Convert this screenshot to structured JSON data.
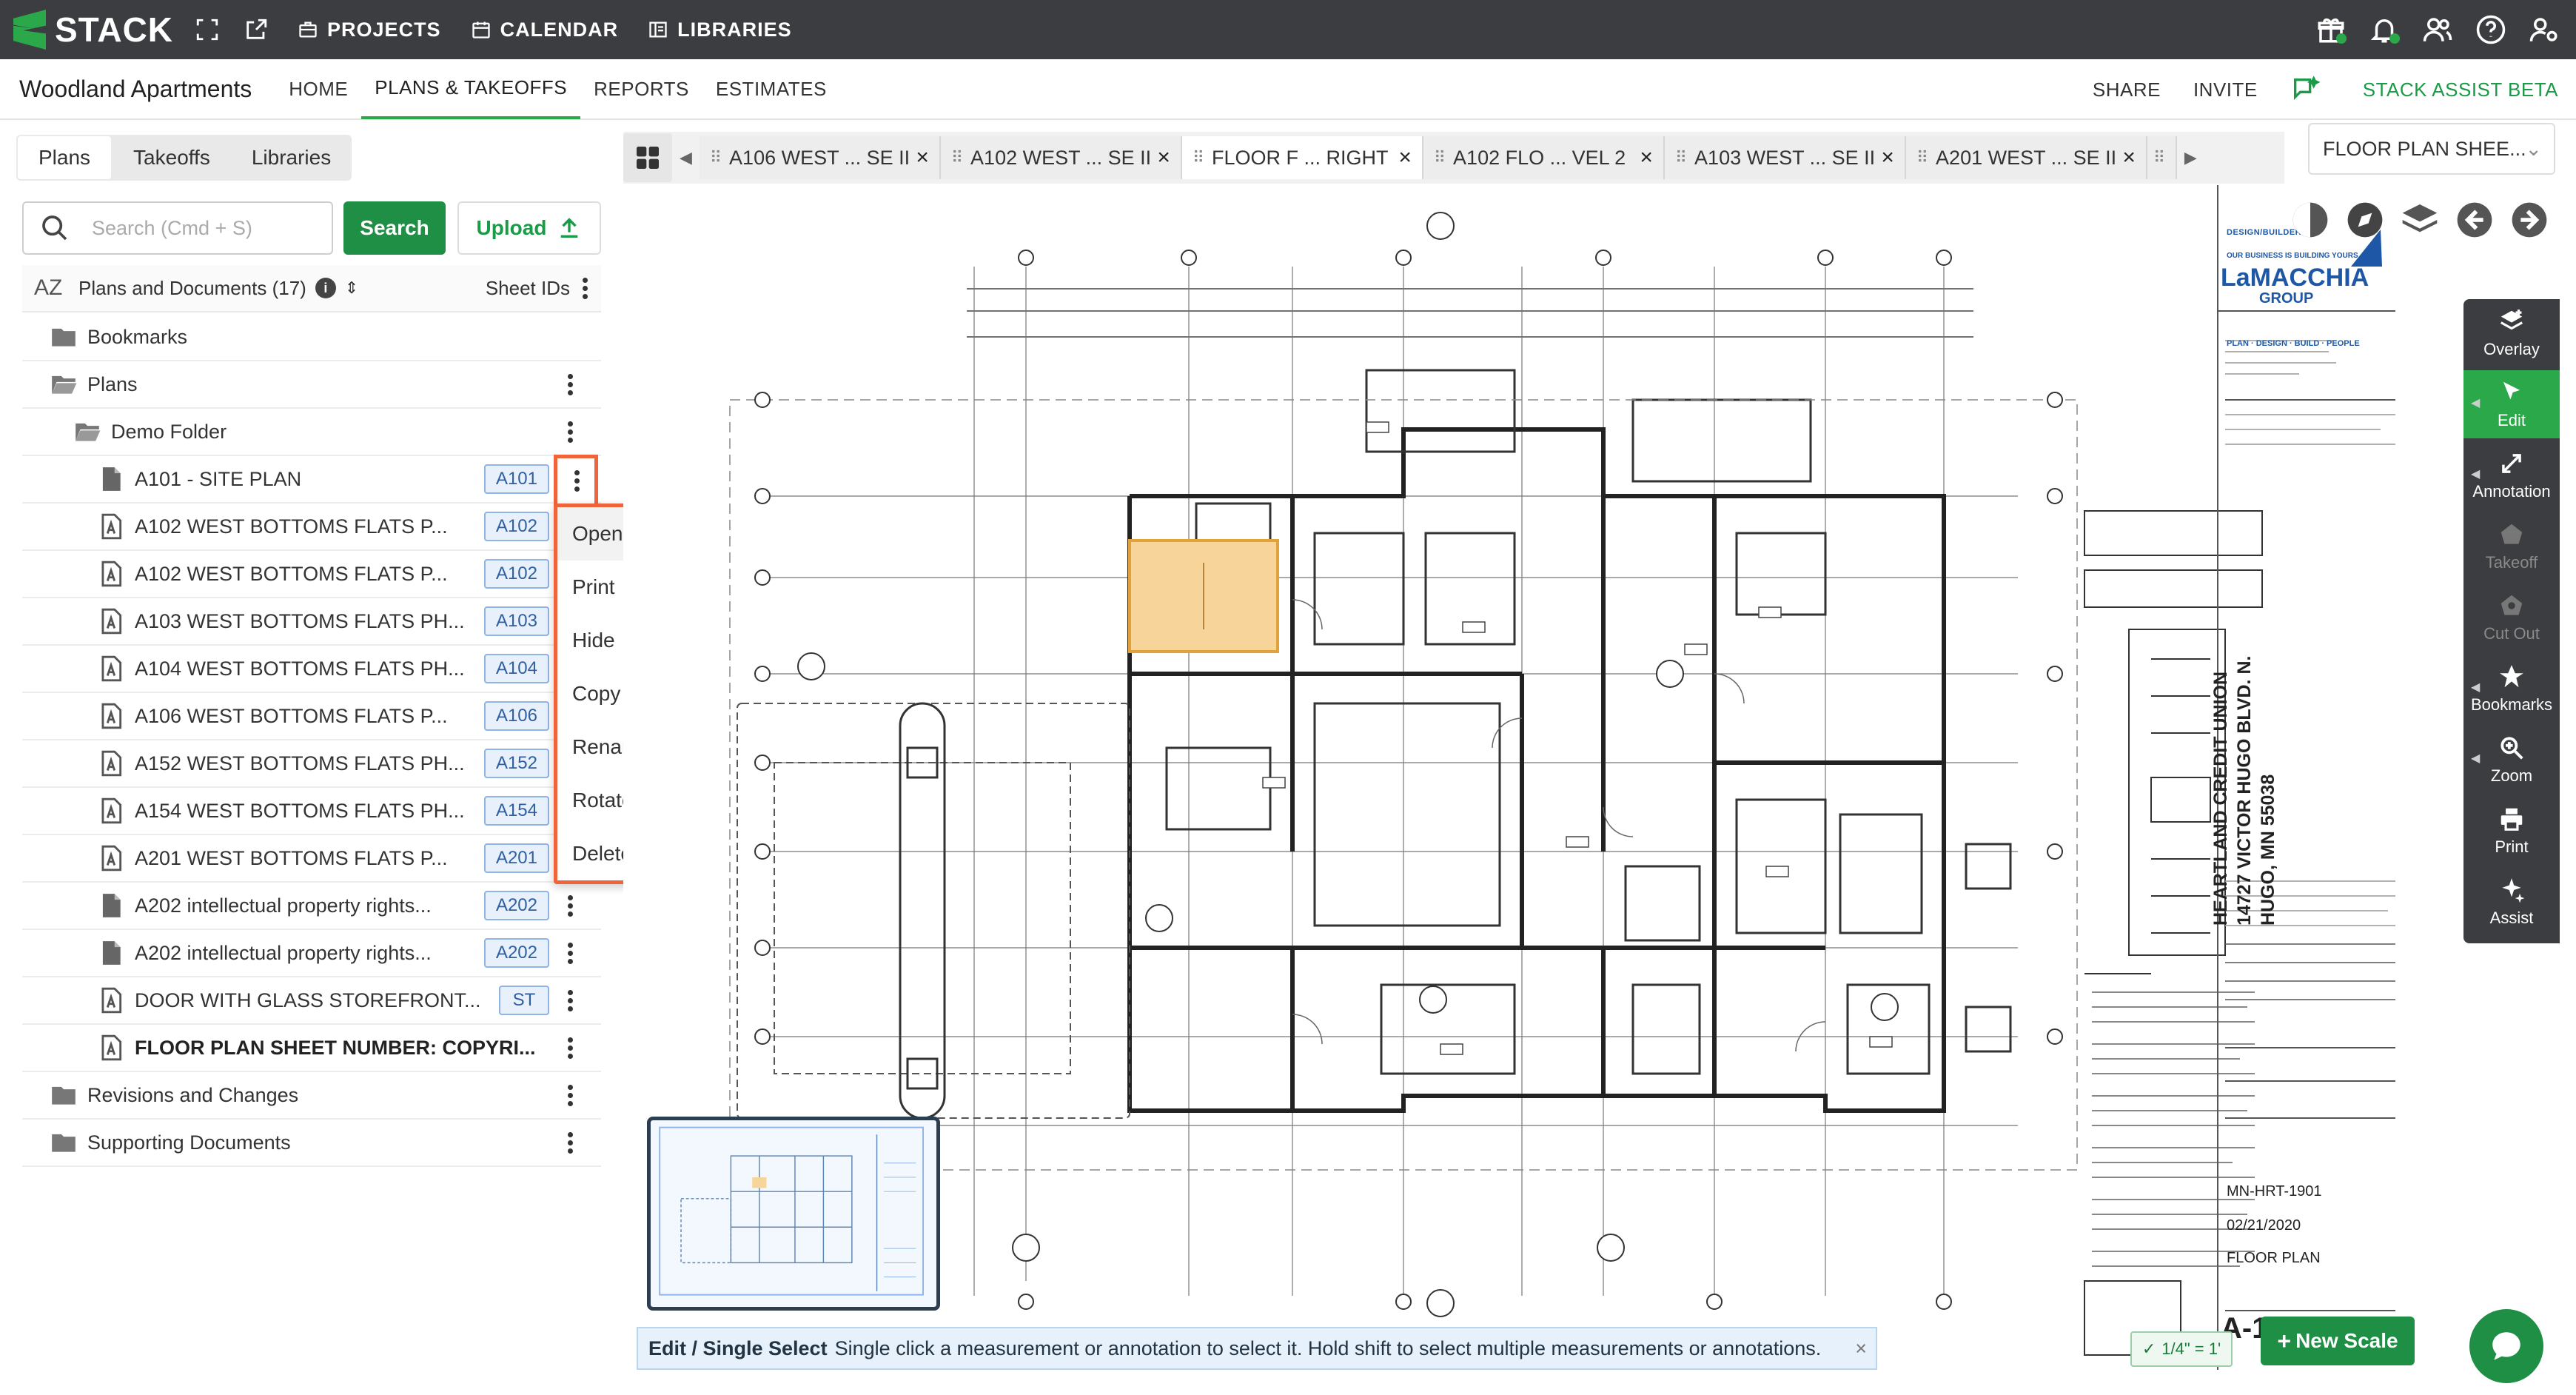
{
  "app": {
    "brand": "STACK"
  },
  "topnav": {
    "items": [
      {
        "label": "PROJECTS",
        "icon": "briefcase-icon"
      },
      {
        "label": "CALENDAR",
        "icon": "calendar-icon"
      },
      {
        "label": "LIBRARIES",
        "icon": "book-icon"
      }
    ],
    "right_icons": [
      "gift-icon",
      "bell-icon",
      "users-icon",
      "help-icon",
      "user-settings-icon"
    ]
  },
  "project": {
    "name": "Woodland Apartments",
    "tabs": [
      "HOME",
      "PLANS & TAKEOFFS",
      "REPORTS",
      "ESTIMATES"
    ],
    "active_tab": "PLANS & TAKEOFFS",
    "share_label": "SHARE",
    "invite_label": "INVITE",
    "assist_label": "STACK ASSIST BETA"
  },
  "leftpanel": {
    "tabs": [
      "Plans",
      "Takeoffs",
      "Libraries"
    ],
    "active_tab": "Plans",
    "search": {
      "placeholder": "Search (Cmd + S)",
      "value": "",
      "button": "Search"
    },
    "upload_label": "Upload",
    "list_header": {
      "sort_icon": "AZ",
      "label": "Plans and Documents (17)",
      "sheet_ids": "Sheet IDs"
    },
    "rows": [
      {
        "type": "folder",
        "indent": 0,
        "label": "Bookmarks",
        "badge": "",
        "menu": false
      },
      {
        "type": "folder-open",
        "indent": 0,
        "label": "Plans",
        "badge": "",
        "menu": true
      },
      {
        "type": "folder-open",
        "indent": 1,
        "label": "Demo Folder",
        "badge": "",
        "menu": true
      },
      {
        "type": "doc",
        "indent": 2,
        "label": "A101 - SITE PLAN",
        "badge": "A101",
        "menu": true
      },
      {
        "type": "plan",
        "indent": 2,
        "label": "A102 WEST BOTTOMS FLATS P...",
        "badge": "A102",
        "menu": true
      },
      {
        "type": "plan",
        "indent": 2,
        "label": "A102 WEST BOTTOMS FLATS P...",
        "badge": "A102",
        "menu": true
      },
      {
        "type": "plan",
        "indent": 2,
        "label": "A103 WEST BOTTOMS FLATS PH...",
        "badge": "A103",
        "menu": true
      },
      {
        "type": "plan",
        "indent": 2,
        "label": "A104 WEST BOTTOMS FLATS PH...",
        "badge": "A104",
        "menu": true
      },
      {
        "type": "plan",
        "indent": 2,
        "label": "A106 WEST BOTTOMS FLATS P...",
        "badge": "A106",
        "menu": true
      },
      {
        "type": "plan",
        "indent": 2,
        "label": "A152 WEST BOTTOMS FLATS PH...",
        "badge": "A152",
        "menu": true
      },
      {
        "type": "plan",
        "indent": 2,
        "label": "A154 WEST BOTTOMS FLATS PH...",
        "badge": "A154",
        "menu": true
      },
      {
        "type": "plan",
        "indent": 2,
        "label": "A201 WEST BOTTOMS FLATS P...",
        "badge": "A201",
        "menu": true
      },
      {
        "type": "doc",
        "indent": 2,
        "label": "A202 intellectual property rights...",
        "badge": "A202",
        "menu": true
      },
      {
        "type": "doc",
        "indent": 2,
        "label": "A202 intellectual property rights...",
        "badge": "A202",
        "menu": true
      },
      {
        "type": "plan",
        "indent": 2,
        "label": "DOOR WITH GLASS STOREFRONT...",
        "badge": "ST",
        "menu": true
      },
      {
        "type": "plan",
        "indent": 2,
        "label": "FLOOR PLAN SHEET NUMBER: COPYRI...",
        "badge": "",
        "menu": true,
        "bold": true
      },
      {
        "type": "folder",
        "indent": 0,
        "label": "Revisions and Changes",
        "badge": "",
        "menu": true
      },
      {
        "type": "folder",
        "indent": 0,
        "label": "Supporting Documents",
        "badge": "",
        "menu": true
      }
    ]
  },
  "context_menu": {
    "items": [
      "Open",
      "Print",
      "Hide",
      "Copy",
      "Rename",
      "Rotate Right",
      "Delete"
    ],
    "highlighted": "Open"
  },
  "sheet_tabs": [
    {
      "label": "A106 WEST ... SE II",
      "active": false
    },
    {
      "label": "A102 WEST ... SE II",
      "active": false
    },
    {
      "label": "FLOOR F ... RIGHT",
      "active": true
    },
    {
      "label": "A102 FLO ... VEL 2",
      "active": false
    },
    {
      "label": "A103 WEST ... SE II",
      "active": false
    },
    {
      "label": "A201 WEST ... SE II",
      "active": false
    }
  ],
  "sheet_selector": "FLOOR PLAN SHEE...",
  "tools": [
    {
      "label": "Overlay",
      "icon": "overlay-icon",
      "state": "normal"
    },
    {
      "label": "Edit",
      "icon": "cursor-icon",
      "state": "active"
    },
    {
      "label": "Annotation",
      "icon": "annotation-icon",
      "state": "normal"
    },
    {
      "label": "Takeoff",
      "icon": "takeoff-icon",
      "state": "disabled"
    },
    {
      "label": "Cut Out",
      "icon": "cutout-icon",
      "state": "disabled"
    },
    {
      "label": "Bookmarks",
      "icon": "star-icon",
      "state": "normal"
    },
    {
      "label": "Zoom",
      "icon": "zoom-icon",
      "state": "normal"
    },
    {
      "label": "Print",
      "icon": "printer-icon",
      "state": "normal"
    },
    {
      "label": "Assist",
      "icon": "sparkle-icon",
      "state": "normal"
    }
  ],
  "status": {
    "mode": "Edit / Single Select",
    "hint": "Single click a measurement or annotation to select it. Hold shift to select multiple measurements or annotations."
  },
  "scale": {
    "value": "1/4\" = 1'",
    "new_scale_label": "New Scale"
  },
  "title_block": {
    "firm_small": "DESIGN/BUILDER",
    "firm_tagline": "OUR BUSINESS IS BUILDING YOURS",
    "firm_name": "LaMACCHIA",
    "firm_group": "GROUP",
    "services": "PLAN · DESIGN · BUILD · PEOPLE",
    "project_name": "HEARTLAND CREDIT UNION",
    "address1": "14727 VICTOR HUGO BLVD. N.",
    "address2": "HUGO, MN 55038",
    "project_number": "MN-HRT-1901",
    "date": "02/21/2020",
    "sheet_title": "FLOOR PLAN",
    "sheet_number": "A-1"
  },
  "colors": {
    "brand_green": "#2ba84a",
    "highlight_orange": "#f0643c",
    "selected_room": "#f7d49a"
  }
}
